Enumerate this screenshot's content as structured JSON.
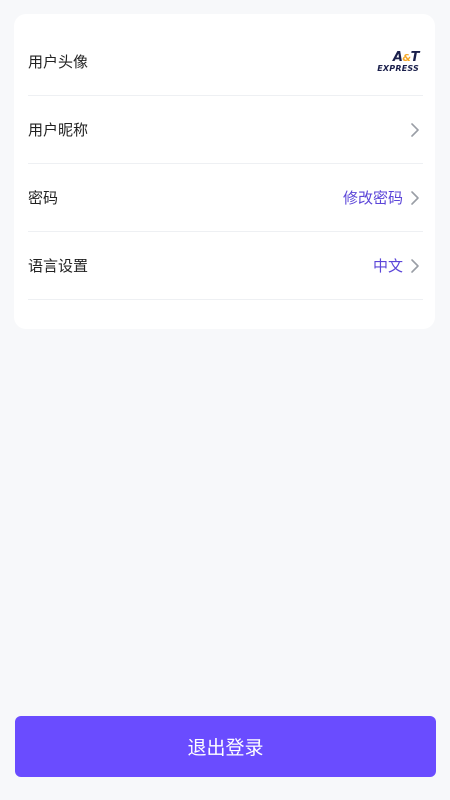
{
  "settings": {
    "rows": [
      {
        "label": "用户头像"
      },
      {
        "label": "用户昵称"
      },
      {
        "label": "密码",
        "value": "修改密码"
      },
      {
        "label": "语言设置",
        "value": "中文"
      }
    ],
    "avatar_logo": {
      "top_a": "A",
      "top_amp": "&",
      "top_t": "T",
      "bottom": "EXPRESS"
    }
  },
  "logout_button": {
    "label": "退出登录"
  },
  "colors": {
    "accent": "#6a4cff",
    "value_text": "#5b45d8",
    "logo_navy": "#1a1f4b",
    "logo_orange": "#f5a623",
    "background": "#f7f8fa"
  },
  "icons": {
    "chevron": "chevron-right-icon"
  }
}
